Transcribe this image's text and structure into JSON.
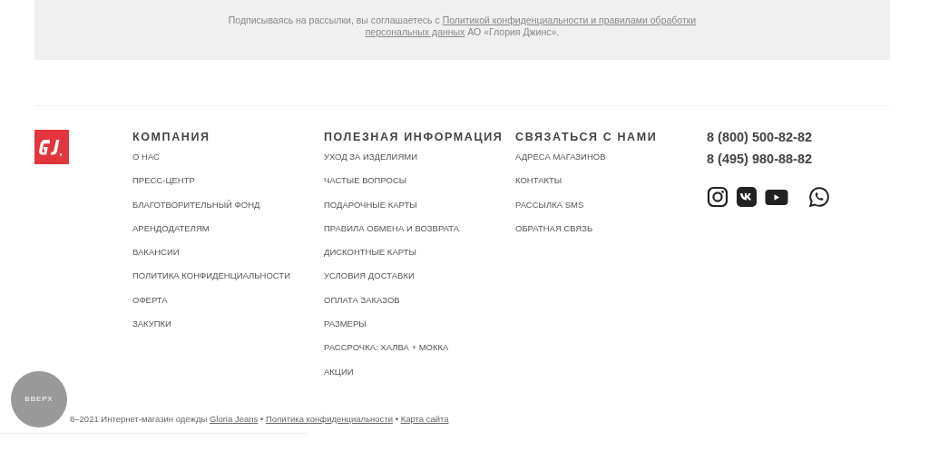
{
  "subscribe_notice": {
    "text": "Подписываясь на рассылки, вы соглашаетесь с ",
    "link_lines": [
      "Политикой конфиденциальности и правилами обработки",
      "персональных данных"
    ],
    "suffix": " АО «Глория Джинс»."
  },
  "columns": [
    {
      "title": "КОМПАНИЯ",
      "links": [
        "О НАС",
        "ПРЕСС-ЦЕНТР",
        "БЛАГОТВОРИТЕЛЬНЫЙ ФОНД",
        "АРЕНДОДАТЕЛЯМ",
        "ВАКАНСИИ",
        "ПОЛИТИКА КОНФИДЕНЦИАЛЬНОСТИ",
        "ОФЕРТА",
        "ЗАКУПКИ"
      ]
    },
    {
      "title": "ПОЛЕЗНАЯ ИНФОРМАЦИЯ",
      "links": [
        "УХОД ЗА ИЗДЕЛИЯМИ",
        "ЧАСТЫЕ ВОПРОСЫ",
        "ПОДАРОЧНЫЕ КАРТЫ",
        "ПРАВИЛА ОБМЕНА И ВОЗВРАТА",
        "ДИСКОНТНЫЕ КАРТЫ",
        "УСЛОВИЯ ДОСТАВКИ",
        "ОПЛАТА ЗАКАЗОВ",
        "РАЗМЕРЫ",
        "РАССРОЧКА: ХАЛВА + МОККА",
        "АКЦИИ"
      ]
    },
    {
      "title": "СВЯЗАТЬСЯ С НАМИ",
      "links": [
        "АДРЕСА МАГАЗИНОВ",
        "КОНТАКТЫ",
        "РАССЫЛКА SMS",
        "ОБРАТНАЯ СВЯЗЬ"
      ]
    }
  ],
  "phones": [
    "8 (800) 500-82-82",
    "8 (495) 980-88-82"
  ],
  "socials": [
    {
      "kind": "instagram"
    },
    {
      "kind": "vk"
    },
    {
      "kind": "youtube"
    },
    {
      "kind": "whatsapp"
    }
  ],
  "copyright": {
    "text": "8–2021 Интернет-магазин одежды",
    "links": [
      "Gloria Jeans",
      "Политика конфиденциальности",
      "Карта сайта"
    ],
    "separators": [
      "•",
      "•"
    ]
  },
  "scroll_top_button": {
    "label": "ВВЕРХ"
  }
}
